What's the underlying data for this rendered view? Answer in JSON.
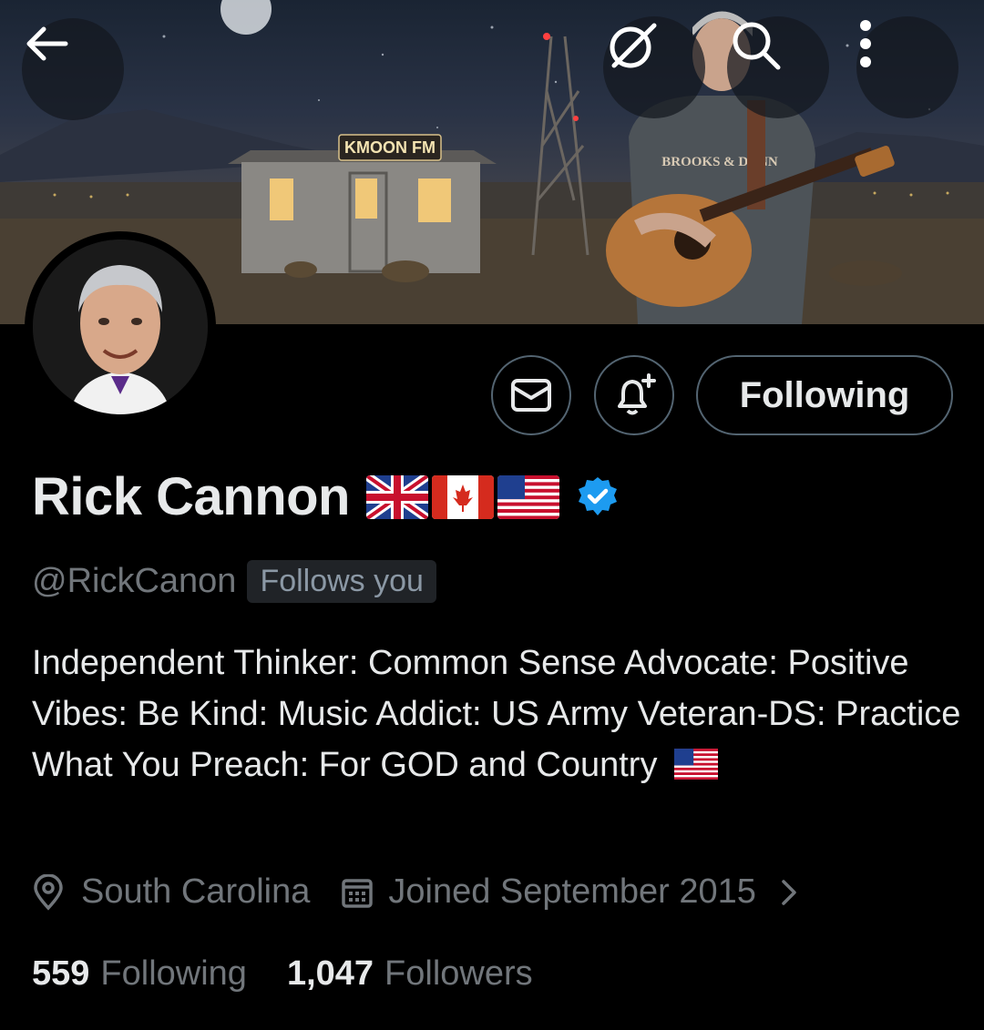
{
  "banner": {
    "sign_text": "KMOON FM",
    "shirt_text": "BROOKS & DUNN"
  },
  "nav": {
    "back_icon": "arrow-left-icon",
    "grok_icon": "grok-icon",
    "search_icon": "search-icon",
    "more_icon": "more-vertical-icon"
  },
  "actions": {
    "message_icon": "envelope-icon",
    "notify_icon": "bell-plus-icon",
    "following_label": "Following"
  },
  "profile": {
    "name": "Rick Cannon",
    "flags": [
      "united-kingdom-flag",
      "canada-flag",
      "united-states-flag"
    ],
    "verified_icon": "verified-badge-icon",
    "handle": "@RickCanon",
    "follows_you": "Follows you",
    "bio": "Independent Thinker: Common Sense Advocate: Positive Vibes: Be Kind: Music Addict: US Army Veteran-DS: Practice What You Preach: For GOD and Country",
    "bio_flag": "united-states-flag",
    "location": "South Carolina",
    "joined": "Joined September 2015"
  },
  "stats": {
    "following_count": "559",
    "following_label": "Following",
    "followers_count": "1,047",
    "followers_label": "Followers"
  },
  "colors": {
    "background": "#000000",
    "text_primary": "#e7e9ea",
    "text_secondary": "#71767b",
    "verified": "#1d9bf0",
    "border": "#536471"
  }
}
